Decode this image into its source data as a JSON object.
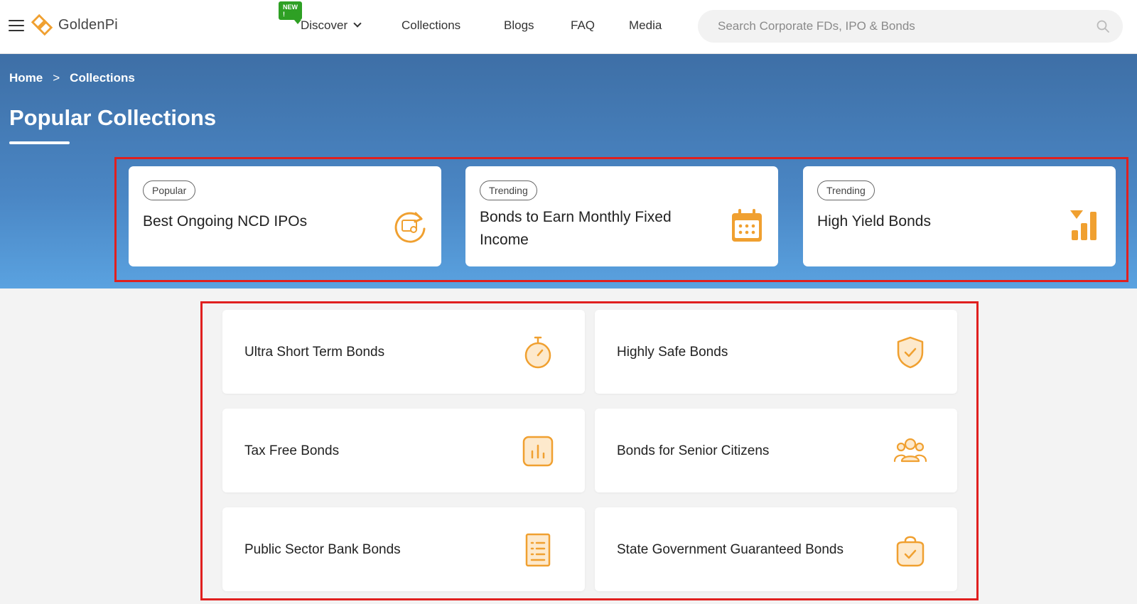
{
  "header": {
    "logo_text": "GoldenPi",
    "new_badge": "NEW !",
    "nav": {
      "discover": "Discover",
      "collections": "Collections",
      "blogs": "Blogs",
      "faq": "FAQ",
      "media": "Media"
    },
    "search_placeholder": "Search Corporate FDs, IPO & Bonds"
  },
  "breadcrumb": {
    "home": "Home",
    "separator": ">",
    "current": "Collections"
  },
  "page_title": "Popular Collections",
  "featured": [
    {
      "badge": "Popular",
      "title": "Best Ongoing NCD IPOs",
      "icon": "refresh-certificate-icon"
    },
    {
      "badge": "Trending",
      "title": "Bonds to Earn Monthly Fixed Income",
      "icon": "calendar-icon"
    },
    {
      "badge": "Trending",
      "title": "High Yield Bonds",
      "icon": "bar-chart-arrow-icon"
    }
  ],
  "collections": [
    {
      "title": "Ultra Short Term Bonds",
      "icon": "stopwatch-icon"
    },
    {
      "title": "Highly Safe Bonds",
      "icon": "shield-check-icon"
    },
    {
      "title": "Tax Free Bonds",
      "icon": "chart-box-icon"
    },
    {
      "title": "Bonds for Senior Citizens",
      "icon": "users-group-icon"
    },
    {
      "title": "Public Sector Bank Bonds",
      "icon": "document-list-icon"
    },
    {
      "title": "State Government Guaranteed Bonds",
      "icon": "bag-check-icon"
    }
  ],
  "colors": {
    "accent": "#f0a030",
    "hero_top": "#3e6fa6",
    "hero_bottom": "#5aa2e0",
    "highlight": "#e0201f",
    "new_badge": "#2ea024"
  }
}
